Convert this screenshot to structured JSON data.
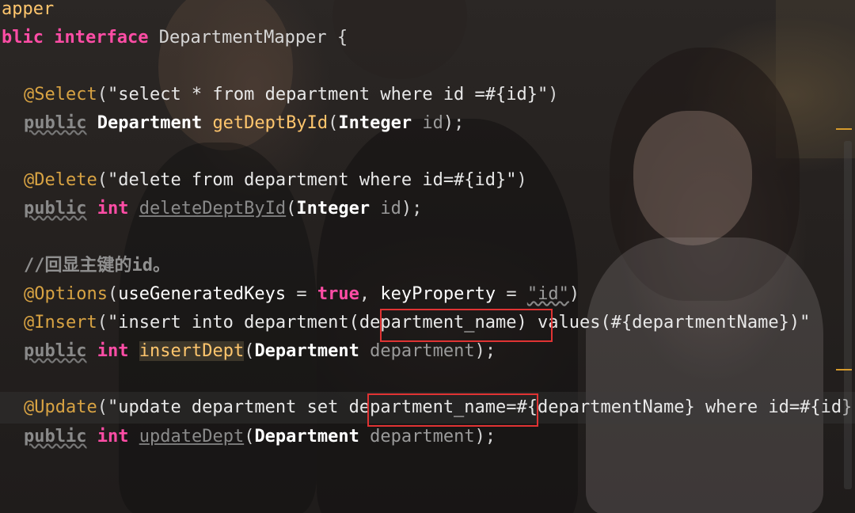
{
  "editor": {
    "lines": {
      "l1": {
        "text": "apper"
      },
      "l2": {
        "kw1": "blic",
        "kw2": "interface",
        "name": "DepartmentMapper",
        "brace": "{"
      },
      "l4": {
        "ann": "@Select",
        "open": "(",
        "str": "\"select * from department where id =#{id}\"",
        "close": ")"
      },
      "l5": {
        "pub": "public",
        "type": "Department",
        "fn": "getDeptById",
        "open": "(",
        "ptype": "Integer",
        "pname": "id",
        "close": ");"
      },
      "l7": {
        "ann": "@Delete",
        "open": "(",
        "str": "\"delete from department where id=#{id}\"",
        "close": ")"
      },
      "l8": {
        "pub": "public",
        "type": "int",
        "fn": "deleteDeptById",
        "open": "(",
        "ptype": "Integer",
        "pname": "id",
        "close": ");"
      },
      "l10": {
        "comment": "//回显主键的id。"
      },
      "l11": {
        "ann": "@Options",
        "open": "(",
        "k1": "useGeneratedKeys",
        "eq1": " = ",
        "v1": "true",
        "comma": ", ",
        "k2": "keyProperty",
        "eq2": " = ",
        "v2": "\"id\"",
        "close": ")"
      },
      "l12": {
        "ann": "@Insert",
        "open": "(",
        "str": "\"insert into department(department_name) values(#{departmentName})\""
      },
      "l13": {
        "pub": "public",
        "type": "int",
        "fn": "insertDept",
        "open": "(",
        "ptype": "Department",
        "pname": "department",
        "close": ");"
      },
      "l15": {
        "ann": "@Update",
        "open": "(",
        "str": "\"update department set department_name=#{departmentName} where id=#{id}\""
      },
      "l16": {
        "pub": "public",
        "type": "int",
        "fn": "updateDept",
        "open": "(",
        "ptype": "Department",
        "pname": "department",
        "close": ");"
      }
    }
  },
  "colors": {
    "keyword": "#ff4da6",
    "annotation": "#d8a343",
    "highlight_box": "#e03333",
    "scroll_marker": "#d69a2c"
  }
}
